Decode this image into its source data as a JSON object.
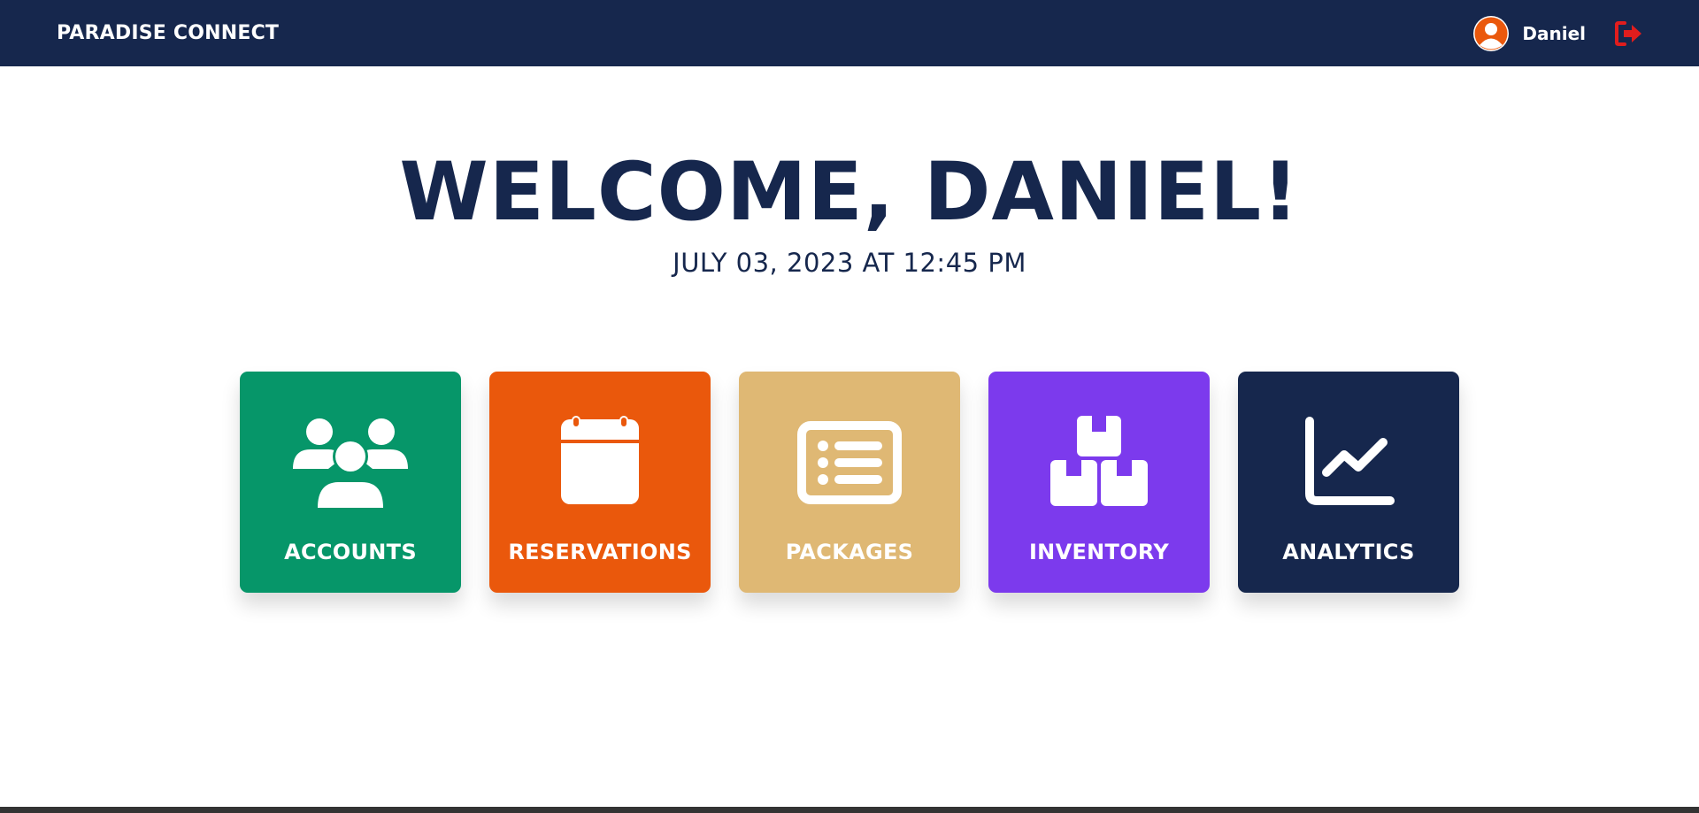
{
  "app": {
    "brand": "PARADISE CONNECT"
  },
  "user": {
    "name": "Daniel"
  },
  "welcome": {
    "title": "WELCOME, DANIEL!",
    "datetime": "JULY 03, 2023 AT 12:45 PM"
  },
  "tiles": [
    {
      "label": "ACCOUNTS",
      "icon": "users-icon",
      "color": "#069669"
    },
    {
      "label": "RESERVATIONS",
      "icon": "calendar-icon",
      "color": "#ea580c"
    },
    {
      "label": "PACKAGES",
      "icon": "list-card-icon",
      "color": "#dfb874"
    },
    {
      "label": "INVENTORY",
      "icon": "boxes-icon",
      "color": "#7c3aed"
    },
    {
      "label": "ANALYTICS",
      "icon": "chart-line-icon",
      "color": "#16274d"
    }
  ],
  "colors": {
    "navbar": "#16274d",
    "avatar": "#ea580c",
    "logout": "#e11d1d",
    "text": "#16274d"
  }
}
